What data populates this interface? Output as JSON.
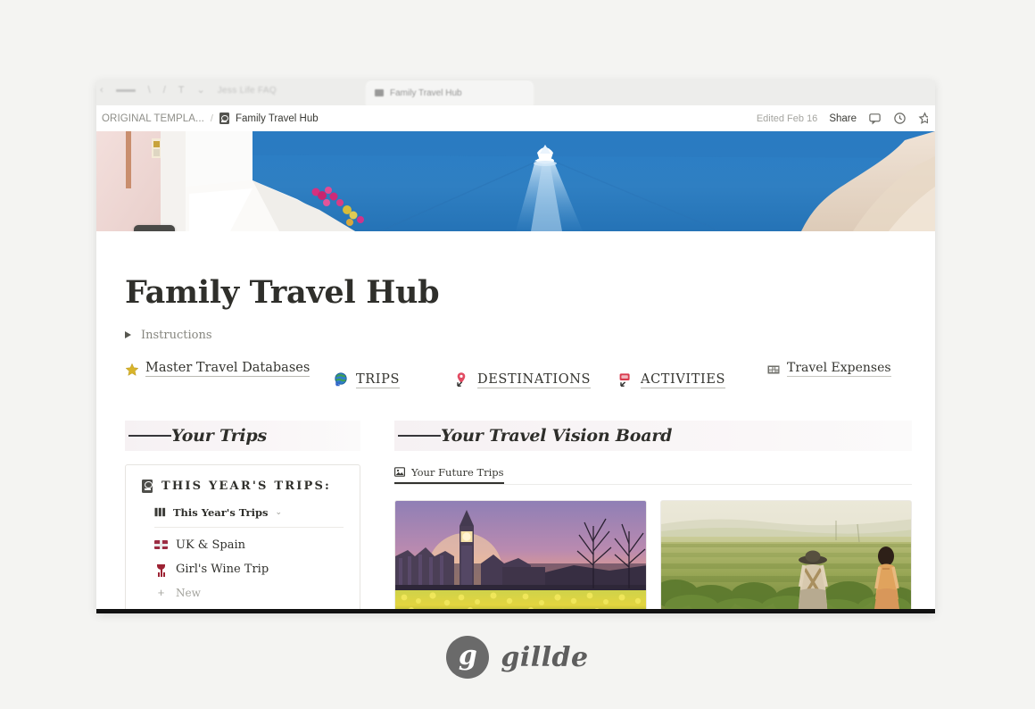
{
  "browser": {
    "tab_label": "Family Travel Hub",
    "toolbar_ghost_text": "Jess Life FAQ"
  },
  "topbar": {
    "breadcrumb_parent": "ORIGINAL TEMPLA...",
    "breadcrumb_separator": "/",
    "breadcrumb_current": "Family Travel Hub",
    "edited_label": "Edited Feb 16",
    "share_label": "Share",
    "comment_icon": "comment-icon",
    "history_icon": "clock-icon",
    "favorite_icon": "star-icon"
  },
  "cover": {
    "alt": "Mediterranean sea cover photo with boat and white cliffs",
    "page_icon": "passport-icon"
  },
  "page": {
    "title": "Family Travel Hub",
    "instructions_label": "Instructions",
    "instructions_toggle_icon": "triangle-right-icon"
  },
  "databases": [
    {
      "label": "Master Travel Databases",
      "icon": "star-icon"
    },
    {
      "label": "TRIPS",
      "icon": "globe-icon"
    },
    {
      "label": "DESTINATIONS",
      "icon": "map-pin-icon"
    },
    {
      "label": "ACTIVITIES",
      "icon": "ticket-icon"
    },
    {
      "label": "Travel Expenses",
      "icon": "table-icon"
    }
  ],
  "sections": {
    "trips": {
      "heading": "Your Trips",
      "card": {
        "icon": "passport-icon",
        "title": "THIS YEAR'S TRIPS:",
        "view_name": "This Year's Trips",
        "view_icon": "board-view-icon",
        "view_chevron": "⌄",
        "items": [
          {
            "name": "UK & Spain",
            "icon": "uk-flag-icon"
          },
          {
            "name": "Girl's Wine Trip",
            "icon": "wine-glass-icon"
          }
        ],
        "new_label": "New",
        "new_icon": "plus-icon"
      }
    },
    "vision_board": {
      "heading": "Your Travel Vision Board",
      "tab_label": "Your Future Trips",
      "tab_icon": "gallery-icon",
      "cards": [
        {
          "alt": "Big Ben and Houses of Parliament at sunset with daffodils"
        },
        {
          "alt": "Two women walking through a green vineyard"
        }
      ]
    }
  },
  "brand": {
    "mark": "g",
    "name": "gillde"
  },
  "colors": {
    "page_bg": "#f4f4f2",
    "sea_blue": "#2d7fc4",
    "accent_dark": "#33332f",
    "brand_gray": "#6a6a6a"
  }
}
